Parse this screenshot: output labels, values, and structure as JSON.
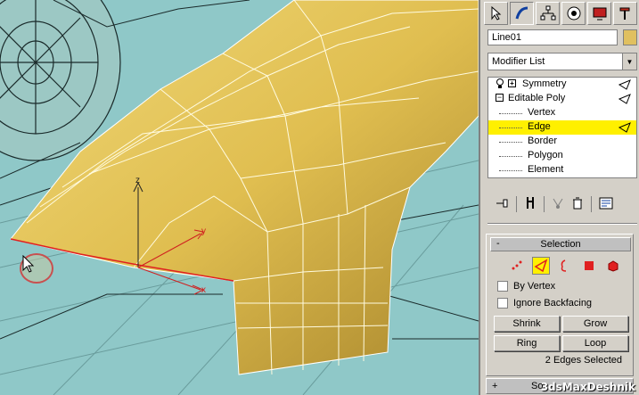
{
  "panel": {
    "object_name": "Line01",
    "modifier_list_label": "Modifier List",
    "stack": [
      {
        "label": "Symmetry",
        "kind": "modifier"
      },
      {
        "label": "Editable Poly",
        "kind": "base"
      },
      {
        "label": "Vertex",
        "kind": "sub"
      },
      {
        "label": "Edge",
        "kind": "sub",
        "selected": true
      },
      {
        "label": "Border",
        "kind": "sub"
      },
      {
        "label": "Polygon",
        "kind": "sub"
      },
      {
        "label": "Element",
        "kind": "sub"
      }
    ]
  },
  "selection": {
    "title": "Selection",
    "collapse_symbol": "-",
    "by_vertex": "By Vertex",
    "ignore_backfacing": "Ignore Backfacing",
    "shrink": "Shrink",
    "grow": "Grow",
    "ring": "Ring",
    "loop": "Loop",
    "status": "2 Edges Selected"
  },
  "bottom_rollout": {
    "symbol": "+",
    "label": "So"
  },
  "viewport": {
    "axis_x": "x",
    "axis_y": "y",
    "axis_z": "z"
  },
  "watermark": "3dsMaxDeshnik",
  "colors": {
    "highlight": "#fff000",
    "mesh": "#e0be50",
    "viewport_bg": "#8fc8c8",
    "selected_edge": "#e02020"
  }
}
